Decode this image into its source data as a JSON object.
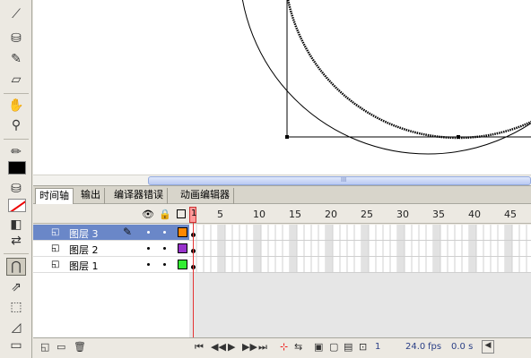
{
  "tabs": [
    "时间轴",
    "输出",
    "编译器错误",
    "动画编辑器"
  ],
  "timeline": {
    "frame_numbers": [
      "1",
      "5",
      "10",
      "15",
      "20",
      "25",
      "30",
      "35",
      "40",
      "45"
    ],
    "layers": [
      {
        "name": "图层 3",
        "selected": true,
        "color": "#ff8800"
      },
      {
        "name": "图层 2",
        "selected": false,
        "color": "#9933cc"
      },
      {
        "name": "图层 1",
        "selected": false,
        "color": "#33ee33"
      }
    ],
    "current_frame": "1",
    "frame_rate": "24.0",
    "frame_rate_unit": "fps",
    "elapsed": "0.0 s"
  },
  "scroll_grip": "III",
  "icons": {
    "eye": "eye-icon",
    "lock": "lock-icon",
    "outline": "outline-icon",
    "pencil": "pencil-icon"
  }
}
